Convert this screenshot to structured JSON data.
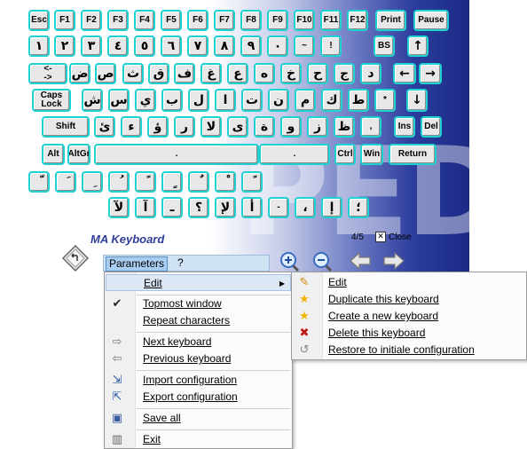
{
  "keyboard": {
    "rows": [
      [
        "Esc",
        "F1",
        "F2",
        "F3",
        "F4",
        "F5",
        "F6",
        "F7",
        "F8",
        "F9",
        "F10",
        "F11",
        "F12",
        "Print",
        "Pause"
      ],
      [
        "١",
        "٢",
        "٣",
        "٤",
        "٥",
        "٦",
        "٧",
        "٨",
        "٩",
        "٠",
        "~",
        "!",
        "BS",
        "↑"
      ],
      [
        "<-\n->",
        "ض",
        "ص",
        "ث",
        "ق",
        "ف",
        "غ",
        "ع",
        "ه",
        "خ",
        "ح",
        "ج",
        "د",
        "←",
        "→"
      ],
      [
        "Caps\nLock",
        "ش",
        "س",
        "ي",
        "ب",
        "ل",
        "ا",
        "ت",
        "ن",
        "م",
        "ك",
        "ط",
        "*",
        "↓"
      ],
      [
        "Shift",
        "ئ",
        "ء",
        "ؤ",
        "ر",
        "لا",
        "ى",
        "ة",
        "و",
        "ز",
        "ظ",
        ",",
        "Ins",
        "Del"
      ],
      [
        "Alt",
        "AltGr",
        ".",
        ".",
        "Ctrl",
        "Win",
        "Return"
      ],
      [
        "ّ",
        "َ",
        "ِ",
        "ُ",
        "ً",
        "ٍ",
        "ٌ",
        "ْ",
        "ً"
      ],
      [
        "لآ",
        "آ",
        "ـ",
        "؟",
        "لإ",
        "أ",
        "-",
        "،",
        "إ",
        "؛"
      ]
    ]
  },
  "app": {
    "title": "MA Keyboard",
    "watermark": "PED"
  },
  "status": {
    "page": "4/5",
    "close_label": "Close",
    "close_checked": "✕"
  },
  "menubar": {
    "parameters": "Parameters",
    "help": "?"
  },
  "main_menu": {
    "items": [
      {
        "label": "Edit",
        "icon": "none"
      },
      {
        "label": "Topmost window",
        "icon": "checkmark-icon",
        "glyph": "✔"
      },
      {
        "label": "Repeat characters",
        "icon": "none"
      },
      {
        "label": "Next keyboard",
        "icon": "arrow-right-icon",
        "glyph": "⇨"
      },
      {
        "label": "Previous keyboard",
        "icon": "arrow-left-icon",
        "glyph": "⇦"
      },
      {
        "label": "Import configuration",
        "icon": "import-icon",
        "glyph": "⇲"
      },
      {
        "label": "Export configuration",
        "icon": "export-icon",
        "glyph": "⇱"
      },
      {
        "label": "Save all",
        "icon": "save-icon",
        "glyph": "▣"
      },
      {
        "label": "Exit",
        "icon": "exit-icon",
        "glyph": "▥"
      }
    ],
    "submenu_arrow": "▶"
  },
  "sub_menu": {
    "items": [
      {
        "label": "Edit",
        "icon": "pencil-icon",
        "glyph": "✎"
      },
      {
        "label": "Duplicate this keyboard",
        "icon": "star-icon",
        "glyph": "★"
      },
      {
        "label": "Create a new keyboard",
        "icon": "star-icon",
        "glyph": "★"
      },
      {
        "label": "Delete this keyboard",
        "icon": "delete-x-icon",
        "glyph": "✖"
      },
      {
        "label": "Restore to initiale configuration",
        "icon": "restore-icon",
        "glyph": "↺"
      }
    ]
  },
  "colors": {
    "key_border": "#1ed2d2",
    "menu_highlight": "#dde8f6",
    "title": "#2f3f9a",
    "star": "#f0b400",
    "delete": "#c01818"
  }
}
